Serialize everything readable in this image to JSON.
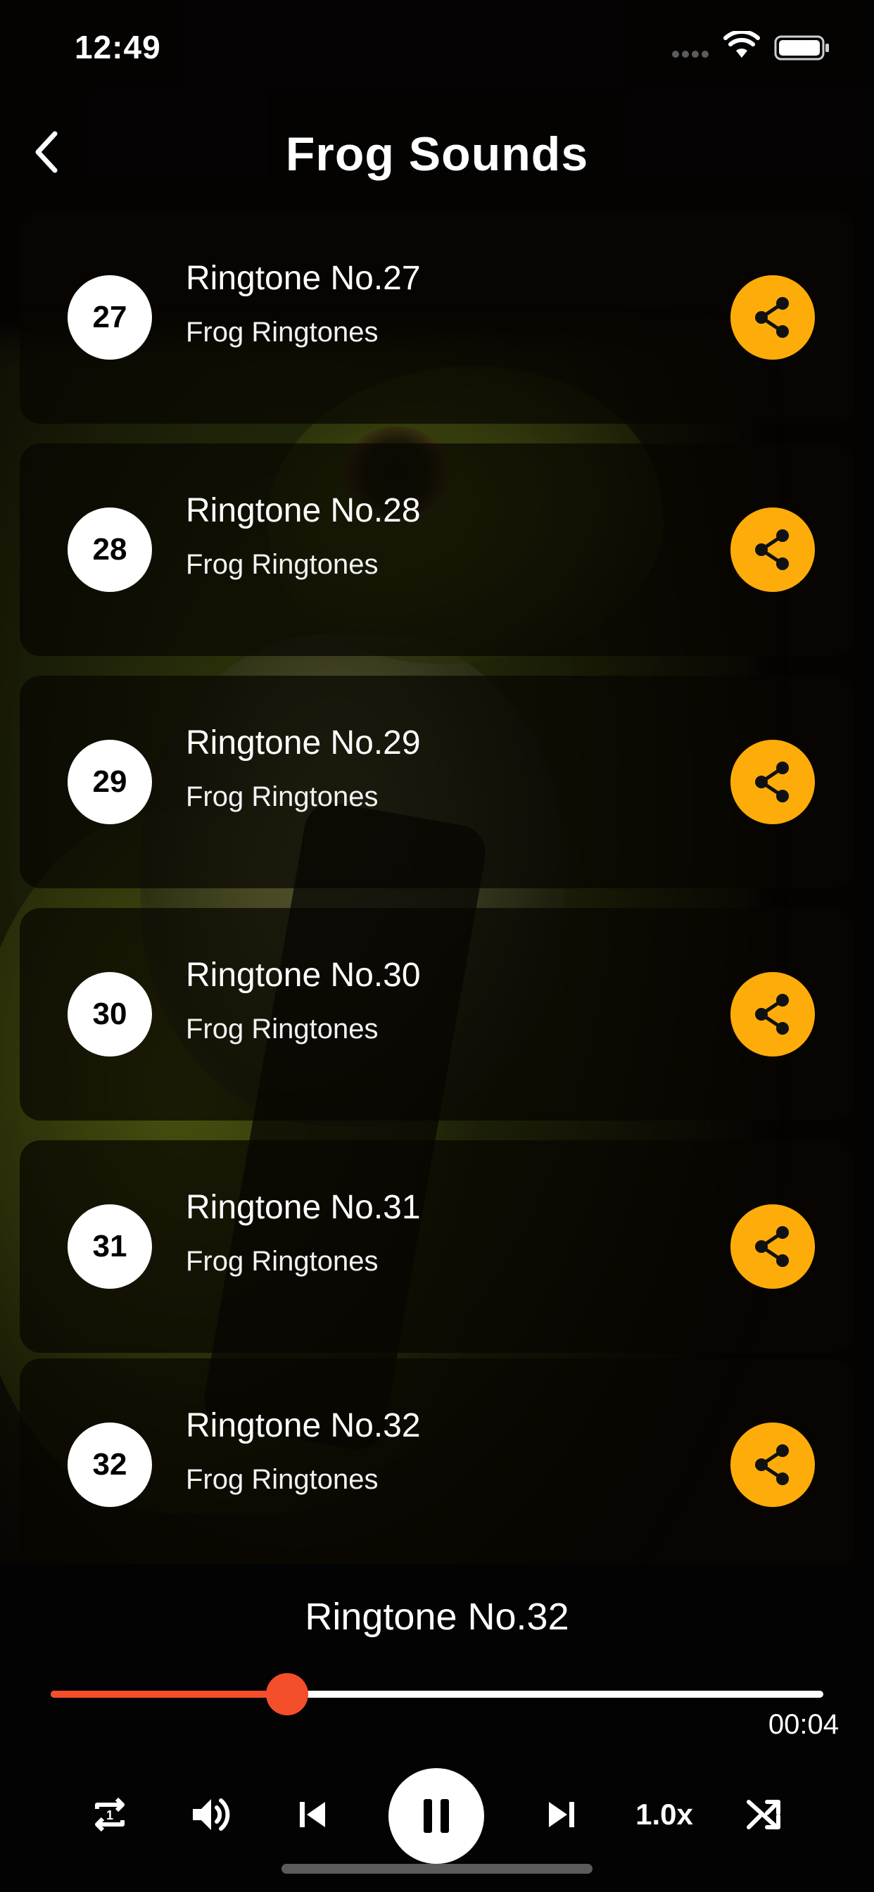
{
  "status_bar": {
    "time": "12:49"
  },
  "header": {
    "title": "Frog Sounds",
    "back_icon": "chevron-left-icon"
  },
  "list": {
    "items": [
      {
        "number": "27",
        "title": "Ringtone No.27",
        "subtitle": "Frog Ringtones"
      },
      {
        "number": "28",
        "title": "Ringtone No.28",
        "subtitle": "Frog Ringtones"
      },
      {
        "number": "29",
        "title": "Ringtone No.29",
        "subtitle": "Frog Ringtones"
      },
      {
        "number": "30",
        "title": "Ringtone No.30",
        "subtitle": "Frog Ringtones"
      },
      {
        "number": "31",
        "title": "Ringtone No.31",
        "subtitle": "Frog Ringtones"
      },
      {
        "number": "32",
        "title": "Ringtone No.32",
        "subtitle": "Frog Ringtones"
      }
    ],
    "share_icon": "share-icon"
  },
  "player": {
    "now_playing": "Ringtone No.32",
    "progress_fraction": 0.306,
    "elapsed": "00:04",
    "speed": "1.0x",
    "icons": [
      "repeat-one-icon",
      "volume-icon",
      "skip-previous-icon",
      "pause-icon",
      "skip-next-icon",
      "shuffle-icon"
    ]
  },
  "colors": {
    "accent": "#fdac0a",
    "progress": "#f44e2a",
    "card_bg": "#080502"
  }
}
